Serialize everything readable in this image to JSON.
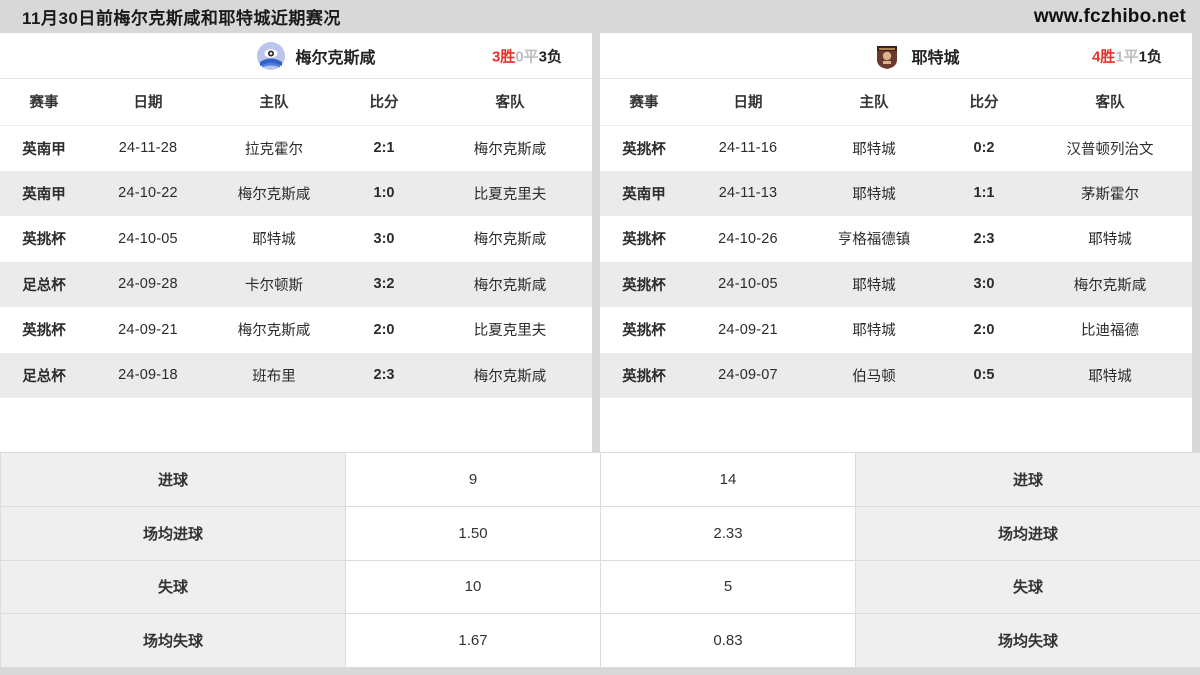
{
  "titlebar": {
    "title": "11月30日前梅尔克斯咸和耶特城近期赛况",
    "site": "www.fczhibo.net"
  },
  "colors": {
    "badge_red": "#f0363a",
    "badge_red_alt": "#ec3a3e",
    "win_red": "#e8312a",
    "draw_gray": "#bdbdbd",
    "loss_dark": "#222222",
    "page_bg": "#d8d8d8",
    "row_alt": "#ebebeb",
    "stat_label_bg": "#efefef"
  },
  "columns": [
    "赛事",
    "日期",
    "主队",
    "比分",
    "客队"
  ],
  "left": {
    "team_name": "梅尔克斯咸",
    "crest_icon": "team-crest-icon",
    "crest_color": "#b9c5ea",
    "record": {
      "wins": "3胜",
      "draws": "0平",
      "losses": "3负"
    },
    "matches": [
      {
        "comp": "英南甲",
        "date": "24-11-28",
        "home": "拉克霍尔",
        "score": "2:1",
        "away": "梅尔克斯咸"
      },
      {
        "comp": "英南甲",
        "date": "24-10-22",
        "home": "梅尔克斯咸",
        "score": "1:0",
        "away": "比夏克里夫"
      },
      {
        "comp": "英挑杯",
        "date": "24-10-05",
        "home": "耶特城",
        "score": "3:0",
        "away": "梅尔克斯咸"
      },
      {
        "comp": "足总杯",
        "date": "24-09-28",
        "home": "卡尔顿斯",
        "score": "3:2",
        "away": "梅尔克斯咸"
      },
      {
        "comp": "英挑杯",
        "date": "24-09-21",
        "home": "梅尔克斯咸",
        "score": "2:0",
        "away": "比夏克里夫"
      },
      {
        "comp": "足总杯",
        "date": "24-09-18",
        "home": "班布里",
        "score": "2:3",
        "away": "梅尔克斯咸"
      }
    ]
  },
  "right": {
    "team_name": "耶特城",
    "crest_icon": "team-crest-icon",
    "crest_color": "#6b3a2e",
    "record": {
      "wins": "4胜",
      "draws": "1平",
      "losses": "1负"
    },
    "matches": [
      {
        "comp": "英挑杯",
        "date": "24-11-16",
        "home": "耶特城",
        "score": "0:2",
        "away": "汉普顿列治文"
      },
      {
        "comp": "英南甲",
        "date": "24-11-13",
        "home": "耶特城",
        "score": "1:1",
        "away": "茅斯霍尔"
      },
      {
        "comp": "英挑杯",
        "date": "24-10-26",
        "home": "亨格福德镇",
        "score": "2:3",
        "away": "耶特城"
      },
      {
        "comp": "英挑杯",
        "date": "24-10-05",
        "home": "耶特城",
        "score": "3:0",
        "away": "梅尔克斯咸"
      },
      {
        "comp": "英挑杯",
        "date": "24-09-21",
        "home": "耶特城",
        "score": "2:0",
        "away": "比迪福德"
      },
      {
        "comp": "英挑杯",
        "date": "24-09-07",
        "home": "伯马顿",
        "score": "0:5",
        "away": "耶特城"
      }
    ]
  },
  "stats": [
    {
      "label_left": "进球",
      "value_left": "9",
      "value_right": "14",
      "label_right": "进球"
    },
    {
      "label_left": "场均进球",
      "value_left": "1.50",
      "value_right": "2.33",
      "label_right": "场均进球"
    },
    {
      "label_left": "失球",
      "value_left": "10",
      "value_right": "5",
      "label_right": "失球"
    },
    {
      "label_left": "场均失球",
      "value_left": "1.67",
      "value_right": "0.83",
      "label_right": "场均失球"
    }
  ]
}
